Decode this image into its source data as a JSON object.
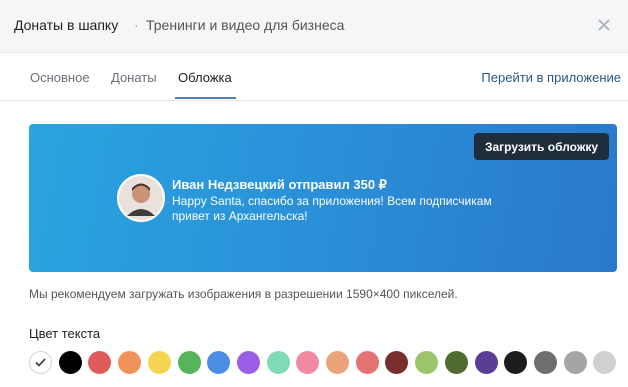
{
  "header": {
    "title": "Донаты в шапку",
    "separator": "·",
    "subtitle": "Тренинги и видео для бизнеса",
    "close_icon": "close-icon"
  },
  "tabs": [
    {
      "label": "Основное",
      "active": false
    },
    {
      "label": "Донаты",
      "active": false
    },
    {
      "label": "Обложка",
      "active": true
    }
  ],
  "goto_app": "Перейти в приложение",
  "banner": {
    "upload_button": "Загрузить обложку",
    "donor_name": "Иван Недзвецкий отправил 350 ₽",
    "message": "Happy Santa, спасибо за приложения! Всем подписчикам привет из Архангельска!",
    "avatar_icon": "avatar"
  },
  "recommendation": "Мы рекомендуем загружать изображения в разрешении 1590×400 пикселей.",
  "text_color": {
    "label": "Цвет текста",
    "selected_index": 0,
    "swatches": [
      "#ffffff",
      "#000000",
      "#e05b5b",
      "#f0935a",
      "#f5d451",
      "#56b45a",
      "#4a8ee6",
      "#9b5de5",
      "#7fdbb6",
      "#f08aa0",
      "#eaa37a",
      "#e57373",
      "#7a2e2e",
      "#9cc46a",
      "#4f6b2f",
      "#5a3e96",
      "#1c1c1c",
      "#6e6e6e",
      "#a5a5a5",
      "#d0d0d0"
    ]
  },
  "accent": "#5181b8"
}
